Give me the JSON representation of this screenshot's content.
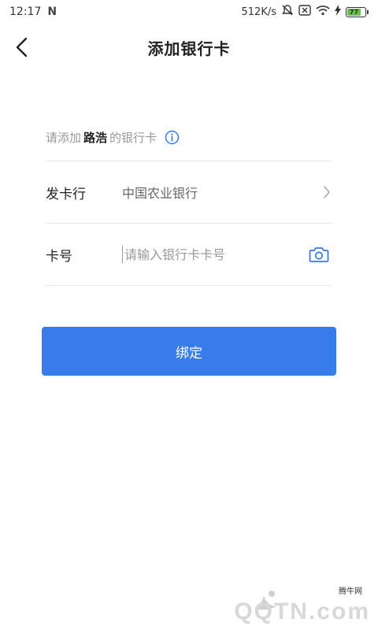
{
  "status_bar": {
    "time": "12:17",
    "network_speed": "512K/s",
    "battery_level": "77"
  },
  "header": {
    "title": "添加银行卡"
  },
  "form": {
    "hint_prefix": "请添加",
    "hint_name": "路浩",
    "hint_suffix": "的银行卡",
    "issuer_label": "发卡行",
    "issuer_value": "中国农业银行",
    "card_number_label": "卡号",
    "card_number_value": "",
    "card_number_placeholder": "请输入银行卡卡号"
  },
  "actions": {
    "bind_label": "绑定"
  },
  "watermark": {
    "small_text": "腾牛网",
    "brand_text": "QQTN.com"
  },
  "colors": {
    "accent": "#3a7bea",
    "divider": "#e6e6e6"
  }
}
